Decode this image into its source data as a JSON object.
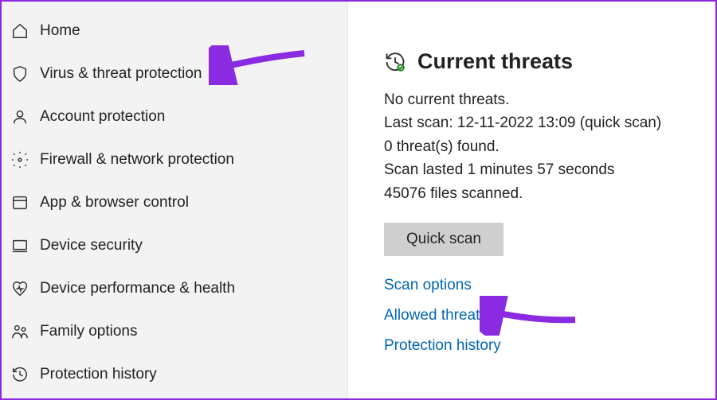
{
  "sidebar": {
    "items": [
      {
        "label": "Home",
        "icon": "home-icon"
      },
      {
        "label": "Virus & threat protection",
        "icon": "shield-icon"
      },
      {
        "label": "Account protection",
        "icon": "account-icon"
      },
      {
        "label": "Firewall & network protection",
        "icon": "network-icon"
      },
      {
        "label": "App & browser control",
        "icon": "browser-icon"
      },
      {
        "label": "Device security",
        "icon": "device-icon"
      },
      {
        "label": "Device performance & health",
        "icon": "health-icon"
      },
      {
        "label": "Family options",
        "icon": "family-icon"
      },
      {
        "label": "Protection history",
        "icon": "history-icon"
      }
    ]
  },
  "main": {
    "section_title": "Current threats",
    "status": {
      "line1": "No current threats.",
      "line2": "Last scan: 12-11-2022 13:09 (quick scan)",
      "line3": "0 threat(s) found.",
      "line4": "Scan lasted 1 minutes 57 seconds",
      "line5": "45076 files scanned."
    },
    "quick_scan_label": "Quick scan",
    "links": {
      "scan_options": "Scan options",
      "allowed_threats": "Allowed threats",
      "protection_history": "Protection history"
    }
  },
  "annotations": {
    "arrow_color": "#8a2be2"
  }
}
